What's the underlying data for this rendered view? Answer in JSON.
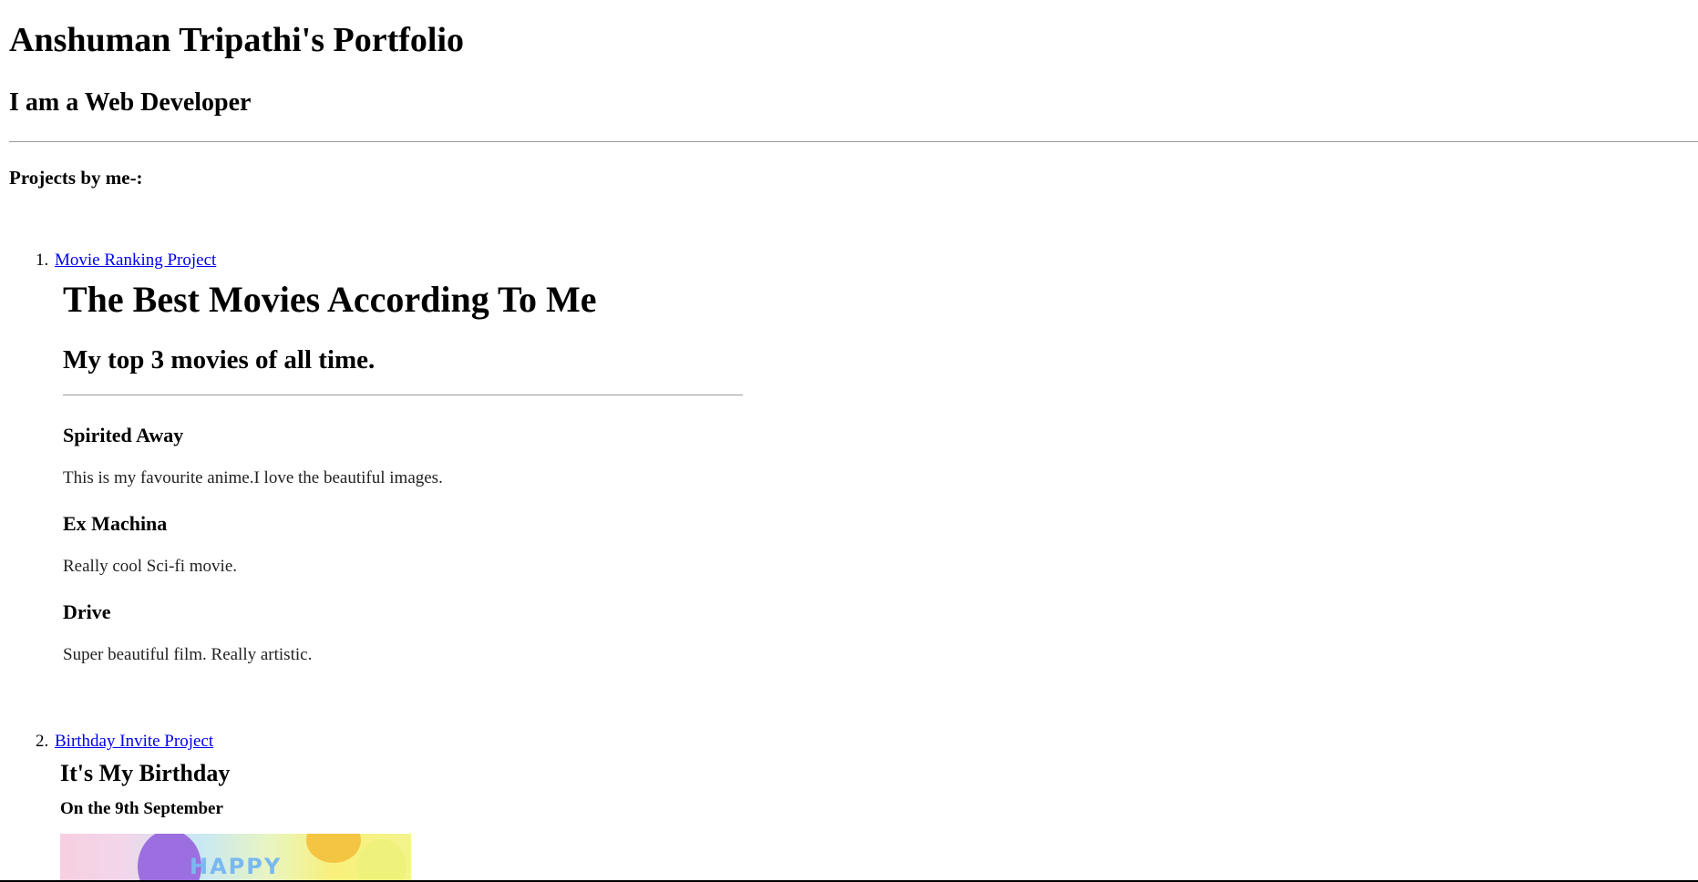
{
  "header": {
    "title": "Anshuman Tripathi's Portfolio",
    "subtitle": "I am a Web Developer"
  },
  "projects_section": {
    "title": "Projects by me-:",
    "items": [
      {
        "number": "1.",
        "link_label": "Movie Ranking Project",
        "preview": {
          "title": "The Best Movies According To Me",
          "subtitle": "My top 3 movies of all time.",
          "movies": [
            {
              "name": "Spirited Away",
              "description": "This is my favourite anime.I love the beautiful images."
            },
            {
              "name": "Ex Machina",
              "description": "Really cool Sci-fi movie."
            },
            {
              "name": "Drive",
              "description": "Super beautiful film. Really artistic."
            }
          ]
        }
      },
      {
        "number": "2.",
        "link_label": "Birthday Invite Project",
        "preview": {
          "title": "It's My Birthday",
          "date_line": "On the 9th September",
          "image_text": "HAPPY"
        }
      }
    ]
  },
  "colors": {
    "link": "#0000ee",
    "rule": "#9a9a9a",
    "background": "#ffffff"
  }
}
